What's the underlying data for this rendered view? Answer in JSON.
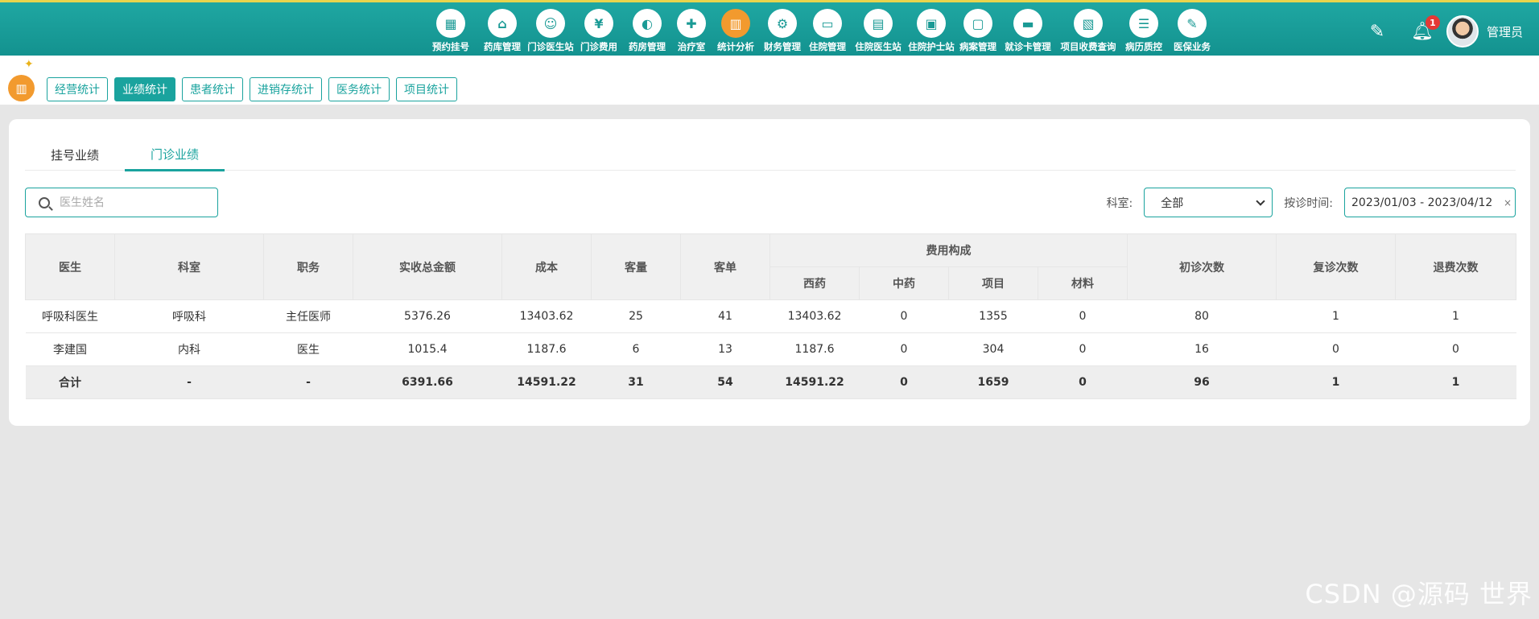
{
  "nav": {
    "items": [
      {
        "label": "预约挂号",
        "icon": "calendar-icon",
        "glyph": "▦"
      },
      {
        "label": "药库管理",
        "icon": "warehouse-icon",
        "glyph": "⌂"
      },
      {
        "label": "门诊医生站",
        "icon": "doctor-icon",
        "glyph": "☺"
      },
      {
        "label": "门诊费用",
        "icon": "yen-icon",
        "glyph": "¥"
      },
      {
        "label": "药房管理",
        "icon": "pill-icon",
        "glyph": "◐"
      },
      {
        "label": "治疗室",
        "icon": "nurse-icon",
        "glyph": "✚"
      },
      {
        "label": "统计分析",
        "icon": "bar-chart-icon",
        "glyph": "▥"
      },
      {
        "label": "财务管理",
        "icon": "gear-icon",
        "glyph": "⚙"
      },
      {
        "label": "住院管理",
        "icon": "bed-icon",
        "glyph": "▭"
      },
      {
        "label": "住院医生站",
        "icon": "id-card-icon",
        "glyph": "▤"
      },
      {
        "label": "住院护士站",
        "icon": "nurse-station-icon",
        "glyph": "▣"
      },
      {
        "label": "病案管理",
        "icon": "record-icon",
        "glyph": "▢"
      },
      {
        "label": "就诊卡管理",
        "icon": "card-icon",
        "glyph": "▬"
      },
      {
        "label": "项目收费查询",
        "icon": "search-doc-icon",
        "glyph": "▧"
      },
      {
        "label": "病历质控",
        "icon": "checklist-icon",
        "glyph": "☰"
      },
      {
        "label": "医保业务",
        "icon": "insurance-icon",
        "glyph": "✎"
      }
    ],
    "active_index": 6
  },
  "header": {
    "notification_count": "1",
    "user_name": "管理员"
  },
  "subtabs": {
    "items": [
      "经营统计",
      "业绩统计",
      "患者统计",
      "进销存统计",
      "医务统计",
      "项目统计"
    ],
    "active_index": 1
  },
  "tabs": {
    "items": [
      "挂号业绩",
      "门诊业绩"
    ],
    "active_index": 1
  },
  "search": {
    "placeholder": "医生姓名",
    "value": ""
  },
  "filters": {
    "dept_label": "科室:",
    "dept_value": "全部",
    "date_label": "按诊时间:",
    "date_value": "2023/01/03 - 2023/04/12"
  },
  "table": {
    "headers": {
      "doctor": "医生",
      "dept": "科室",
      "title": "职务",
      "revenue": "实收总金额",
      "cost": "成本",
      "volume": "客量",
      "per": "客单",
      "fee_group": "费用构成",
      "western": "西药",
      "chinese": "中药",
      "item": "项目",
      "material": "材料",
      "first": "初诊次数",
      "revisit": "复诊次数",
      "refund": "退费次数"
    },
    "rows": [
      [
        "呼吸科医生",
        "呼吸科",
        "主任医师",
        "5376.26",
        "13403.62",
        "25",
        "41",
        "13403.62",
        "0",
        "1355",
        "0",
        "80",
        "1",
        "1"
      ],
      [
        "李建国",
        "内科",
        "医生",
        "1015.4",
        "1187.6",
        "6",
        "13",
        "1187.6",
        "0",
        "304",
        "0",
        "16",
        "0",
        "0"
      ]
    ],
    "total": [
      "合计",
      "-",
      "-",
      "6391.66",
      "14591.22",
      "31",
      "54",
      "14591.22",
      "0",
      "1659",
      "0",
      "96",
      "1",
      "1"
    ]
  },
  "watermark": "CSDN @源码 世界",
  "colors": {
    "primary": "#1aa39e",
    "active_nav": "#f29a2e",
    "badge": "#e53935"
  }
}
